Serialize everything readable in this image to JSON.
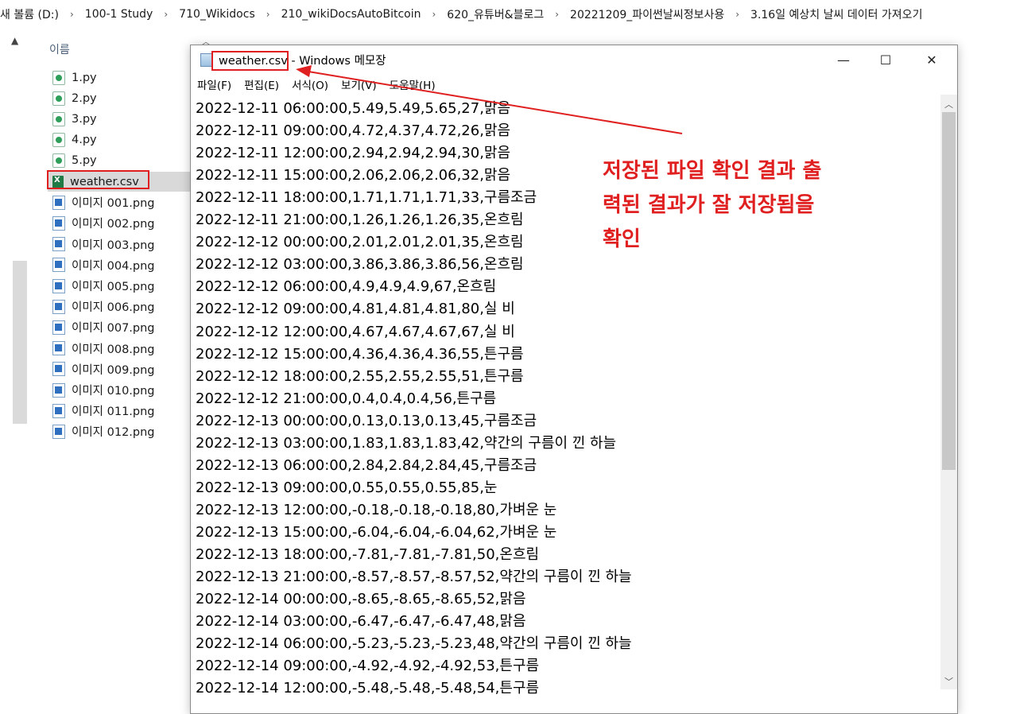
{
  "explorer": {
    "breadcrumb": [
      "새 볼륨 (D:)",
      "100-1 Study",
      "710_Wikidocs",
      "210_wikiDocsAutoBitcoin",
      "620_유튜버&블로그",
      "20221209_파이썬날씨정보사용",
      "3.16일 예상치 날씨 데이터 가져오기"
    ],
    "breadcrumb_separator": "›",
    "column_header": "이름",
    "files": [
      {
        "name": "1.py",
        "type": "py"
      },
      {
        "name": "2.py",
        "type": "py"
      },
      {
        "name": "3.py",
        "type": "py"
      },
      {
        "name": "4.py",
        "type": "py"
      },
      {
        "name": "5.py",
        "type": "py"
      },
      {
        "name": "weather.csv",
        "type": "csv",
        "selected": true
      },
      {
        "name": "이미지 001.png",
        "type": "png"
      },
      {
        "name": "이미지 002.png",
        "type": "png"
      },
      {
        "name": "이미지 003.png",
        "type": "png"
      },
      {
        "name": "이미지 004.png",
        "type": "png"
      },
      {
        "name": "이미지 005.png",
        "type": "png"
      },
      {
        "name": "이미지 006.png",
        "type": "png"
      },
      {
        "name": "이미지 007.png",
        "type": "png"
      },
      {
        "name": "이미지 008.png",
        "type": "png"
      },
      {
        "name": "이미지 009.png",
        "type": "png"
      },
      {
        "name": "이미지 010.png",
        "type": "png"
      },
      {
        "name": "이미지 011.png",
        "type": "png"
      },
      {
        "name": "이미지 012.png",
        "type": "png"
      }
    ]
  },
  "notepad": {
    "title_filename": "weather.csv",
    "title_suffix": " - Windows 메모장",
    "menu": [
      "파일(F)",
      "편집(E)",
      "서식(O)",
      "보기(V)",
      "도움말(H)"
    ],
    "window_buttons": {
      "minimize": "—",
      "maximize": "☐",
      "close": "✕"
    },
    "lines": [
      "2022-12-11 06:00:00,5.49,5.49,5.65,27,맑음",
      "2022-12-11 09:00:00,4.72,4.37,4.72,26,맑음",
      "2022-12-11 12:00:00,2.94,2.94,2.94,30,맑음",
      "2022-12-11 15:00:00,2.06,2.06,2.06,32,맑음",
      "2022-12-11 18:00:00,1.71,1.71,1.71,33,구름조금",
      "2022-12-11 21:00:00,1.26,1.26,1.26,35,온흐림",
      "2022-12-12 00:00:00,2.01,2.01,2.01,35,온흐림",
      "2022-12-12 03:00:00,3.86,3.86,3.86,56,온흐림",
      "2022-12-12 06:00:00,4.9,4.9,4.9,67,온흐림",
      "2022-12-12 09:00:00,4.81,4.81,4.81,80,실 비",
      "2022-12-12 12:00:00,4.67,4.67,4.67,67,실 비",
      "2022-12-12 15:00:00,4.36,4.36,4.36,55,튼구름",
      "2022-12-12 18:00:00,2.55,2.55,2.55,51,튼구름",
      "2022-12-12 21:00:00,0.4,0.4,0.4,56,튼구름",
      "2022-12-13 00:00:00,0.13,0.13,0.13,45,구름조금",
      "2022-12-13 03:00:00,1.83,1.83,1.83,42,약간의 구름이 낀 하늘",
      "2022-12-13 06:00:00,2.84,2.84,2.84,45,구름조금",
      "2022-12-13 09:00:00,0.55,0.55,0.55,85,눈",
      "2022-12-13 12:00:00,-0.18,-0.18,-0.18,80,가벼운 눈",
      "2022-12-13 15:00:00,-6.04,-6.04,-6.04,62,가벼운 눈",
      "2022-12-13 18:00:00,-7.81,-7.81,-7.81,50,온흐림",
      "2022-12-13 21:00:00,-8.57,-8.57,-8.57,52,약간의 구름이 낀 하늘",
      "2022-12-14 00:00:00,-8.65,-8.65,-8.65,52,맑음",
      "2022-12-14 03:00:00,-6.47,-6.47,-6.47,48,맑음",
      "2022-12-14 06:00:00,-5.23,-5.23,-5.23,48,약간의 구름이 낀 하늘",
      "2022-12-14 09:00:00,-4.92,-4.92,-4.92,53,튼구름",
      "2022-12-14 12:00:00,-5.48,-5.48,-5.48,54,튼구름"
    ]
  },
  "annotation": {
    "lines": [
      "저장된 파일 확인 결과 출",
      "력된 결과가 잘 저장됨을",
      "확인"
    ],
    "color": "#e02020"
  }
}
